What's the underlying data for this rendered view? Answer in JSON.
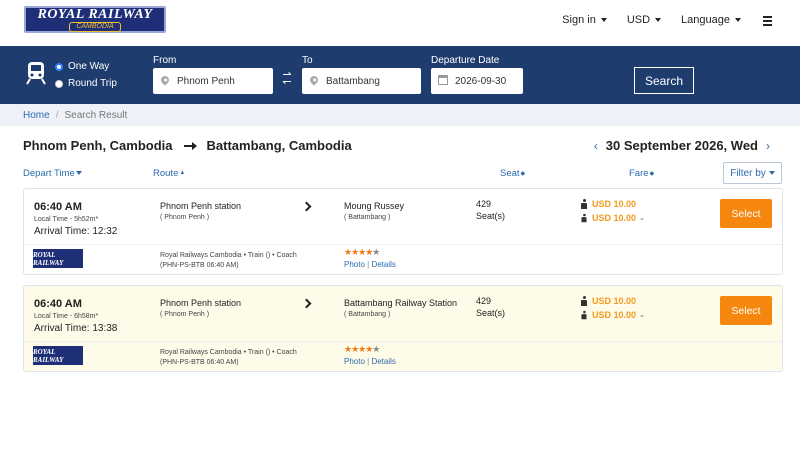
{
  "brand": {
    "logo_line1": "ROYAL RAILWAY",
    "logo_line2": "CAMBODIA"
  },
  "topnav": {
    "signin": "Sign in",
    "currency": "USD",
    "language": "Language"
  },
  "search": {
    "trip_one_way": "One Way",
    "trip_round": "Round Trip",
    "selected_trip": "One Way",
    "from_label": "From",
    "from_value": "Phnom Penh",
    "to_label": "To",
    "to_value": "Battambang",
    "date_label": "Departure Date",
    "date_value": "2026-09-30",
    "search_button": "Search"
  },
  "breadcrumb": {
    "home": "Home",
    "current": "Search Result"
  },
  "route": {
    "from": "Phnom Penh, Cambodia",
    "to": "Battambang, Cambodia",
    "date": "30 September 2026, Wed"
  },
  "columns": {
    "depart": "Depart Time",
    "route": "Route",
    "seat": "Seat",
    "fare": "Fare",
    "filter": "Filter by"
  },
  "results": [
    {
      "depart": "06:40 AM",
      "local_time": "Local Time - 5h52m*",
      "arrival": "Arrival Time: 12:32",
      "from_station": "Phnom Penh station",
      "from_city": "( Phnom Penh )",
      "to_station": "Moung Russey",
      "to_city": "( Battambang )",
      "seats": "429",
      "seat_label": "Seat(s)",
      "fare_adult": "USD 10.00",
      "fare_child": "USD 10.00",
      "select": "Select",
      "operator_logo": "ROYAL RAILWAY",
      "operator_line1": "Royal Railways Cambodia • Train () • Coach",
      "operator_line2": "(PHN-PS-BTB 06:40 AM)",
      "rating": 4,
      "photo": "Photo",
      "details": "Details"
    },
    {
      "depart": "06:40 AM",
      "local_time": "Local Time - 6h58m*",
      "arrival": "Arrival Time: 13:38",
      "from_station": "Phnom Penh station",
      "from_city": "( Phnom Penh )",
      "to_station": "Battambang Railway Station",
      "to_city": "( Battambang )",
      "seats": "429",
      "seat_label": "Seat(s)",
      "fare_adult": "USD 10.00",
      "fare_child": "USD 10.00",
      "select": "Select",
      "operator_logo": "ROYAL RAILWAY",
      "operator_line1": "Royal Railways Cambodia • Train () • Coach",
      "operator_line2": "(PHN-PS-BTB 06:40 AM)",
      "rating": 4,
      "photo": "Photo",
      "details": "Details"
    }
  ],
  "colors": {
    "header_bar": "#1e3d6e",
    "select_button": "#f5860e",
    "fare_text": "#f29a1e",
    "link": "#2b6cb0",
    "highlight_row": "#fffbe9"
  }
}
